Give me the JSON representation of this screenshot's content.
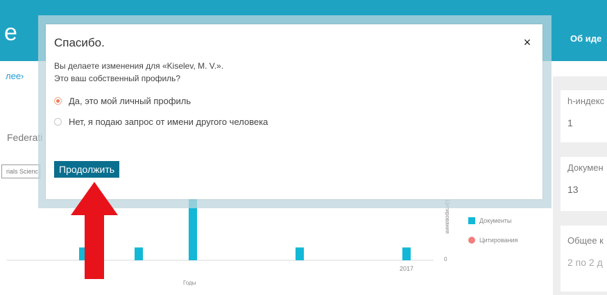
{
  "header": {
    "brand_letter": "e",
    "right_text": "Об иде"
  },
  "page": {
    "back_link": "лее›",
    "federation_text": "Federati",
    "subject_filter": "rials Scienc"
  },
  "metrics": [
    {
      "label": "h-индекс",
      "value": "1"
    },
    {
      "label": "Докумен",
      "value": "13"
    },
    {
      "label": "Общее к",
      "value": "2 по 2 д"
    }
  ],
  "chart_data": {
    "type": "bar",
    "x_axis_label": "Годы",
    "y2_axis_label": "Цитирования",
    "visible_tick_labels": [
      "2017"
    ],
    "y2_zero_label": "0",
    "legend": [
      {
        "name": "Документы",
        "color": "#12b8d6"
      },
      {
        "name": "Цитирования",
        "color": "#f07f7f"
      }
    ],
    "series": [
      {
        "name": "Документы",
        "values": [
          1,
          1,
          9,
          1,
          1
        ]
      }
    ]
  },
  "modal": {
    "title": "Спасибо.",
    "close_label": "×",
    "line1": "Вы делаете изменения для «Kiselev, M. V.».",
    "line2": "Это ваш собственный профиль?",
    "option_self": "Да, это мой личный профиль",
    "option_other": "Нет, я подаю запрос от имени другого человека",
    "continue_label": "Продолжить"
  },
  "colors": {
    "header_bg": "#1fa3c3",
    "bar": "#12b8d6",
    "button": "#0a6f8e",
    "arrow": "#e8131a"
  }
}
